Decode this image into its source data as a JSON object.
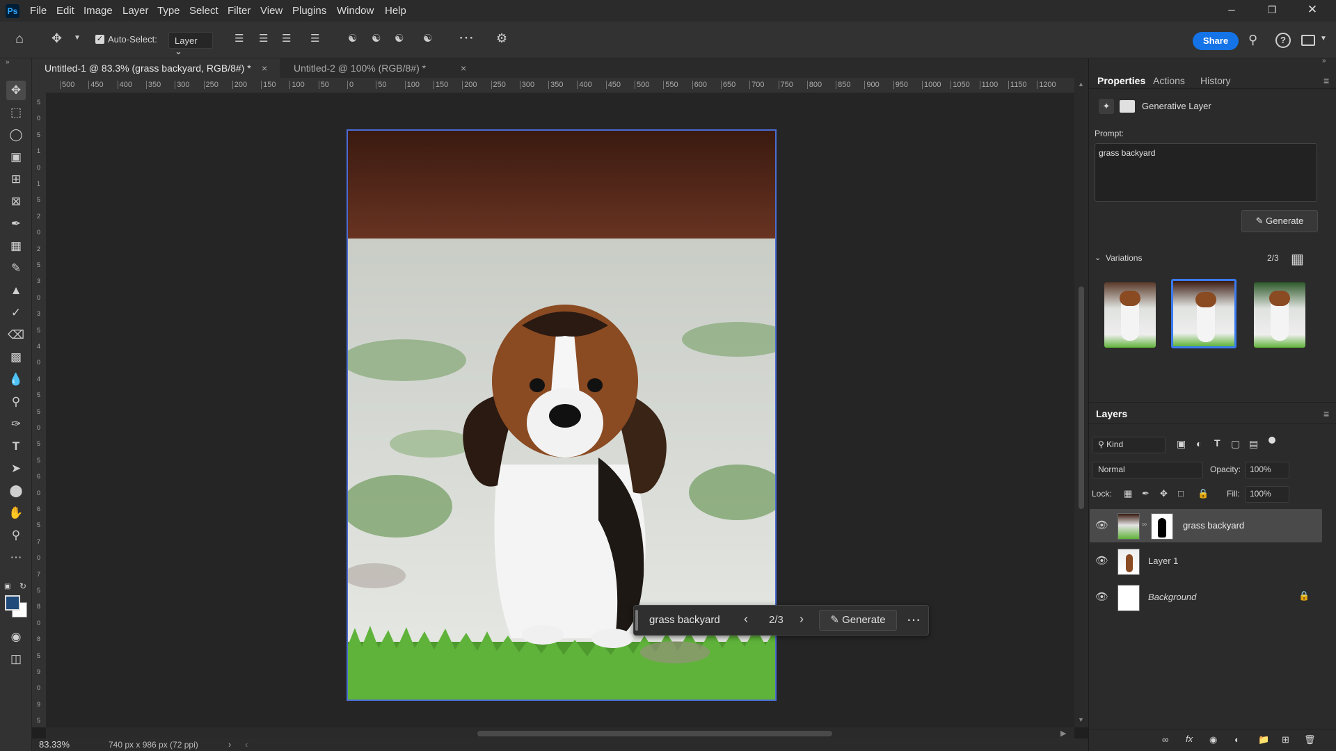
{
  "menu": {
    "app_icon": "Ps",
    "items": [
      "File",
      "Edit",
      "Image",
      "Layer",
      "Type",
      "Select",
      "Filter",
      "View",
      "Plugins",
      "Window",
      "Help"
    ]
  },
  "options": {
    "auto_select_label": "Auto-Select:",
    "auto_select_checked": true,
    "target_value": "Layer",
    "share_label": "Share"
  },
  "tabs": [
    {
      "label": "Untitled-1 @ 83.3% (grass backyard, RGB/8#) *",
      "active": true
    },
    {
      "label": "Untitled-2 @ 100% (RGB/8#) *",
      "active": false
    }
  ],
  "ruler_h": [
    "500",
    "450",
    "400",
    "350",
    "300",
    "250",
    "200",
    "150",
    "100",
    "50",
    "0",
    "50",
    "100",
    "150",
    "200",
    "250",
    "300",
    "350",
    "400",
    "450",
    "500",
    "550",
    "600",
    "650",
    "700",
    "750",
    "800",
    "850",
    "900",
    "950",
    "1000",
    "1050",
    "1100",
    "1150",
    "1200"
  ],
  "ruler_v": [
    "5",
    "0",
    "5",
    "1",
    "0",
    "1",
    "5",
    "2",
    "0",
    "2",
    "5",
    "3",
    "0",
    "3",
    "5",
    "4",
    "0",
    "4",
    "5",
    "5",
    "0",
    "5",
    "5",
    "6",
    "0",
    "6",
    "5",
    "7",
    "0",
    "7",
    "5",
    "8",
    "0",
    "8",
    "5",
    "9",
    "0",
    "9",
    "5"
  ],
  "status": {
    "zoom": "83.33%",
    "doc_info": "740 px x 986 px (72 ppi)"
  },
  "context_bar": {
    "prompt": "grass backyard",
    "variation_counter": "2/3",
    "generate_label": "Generate"
  },
  "properties": {
    "tabs": [
      "Properties",
      "Actions",
      "History"
    ],
    "layer_type": "Generative Layer",
    "prompt_label": "Prompt:",
    "prompt_value": "grass backyard",
    "generate_label": "Generate",
    "variations_label": "Variations",
    "variations_counter": "2/3",
    "selected_variation": 2
  },
  "layers": {
    "title": "Layers",
    "filter_kind": "Kind",
    "blend_mode": "Normal",
    "opacity_label": "Opacity:",
    "opacity_value": "100%",
    "lock_label": "Lock:",
    "fill_label": "Fill:",
    "fill_value": "100%",
    "items": [
      {
        "name": "grass backyard",
        "selected": true,
        "has_mask": true,
        "locked": false
      },
      {
        "name": "Layer 1",
        "selected": false,
        "has_mask": false,
        "locked": false
      },
      {
        "name": "Background",
        "selected": false,
        "has_mask": false,
        "locked": true
      }
    ]
  },
  "colors": {
    "accent": "#1473e6",
    "selection": "#4a6cd4",
    "foreground_swatch": "#1f4a7a",
    "background_swatch": "#ffffff"
  }
}
